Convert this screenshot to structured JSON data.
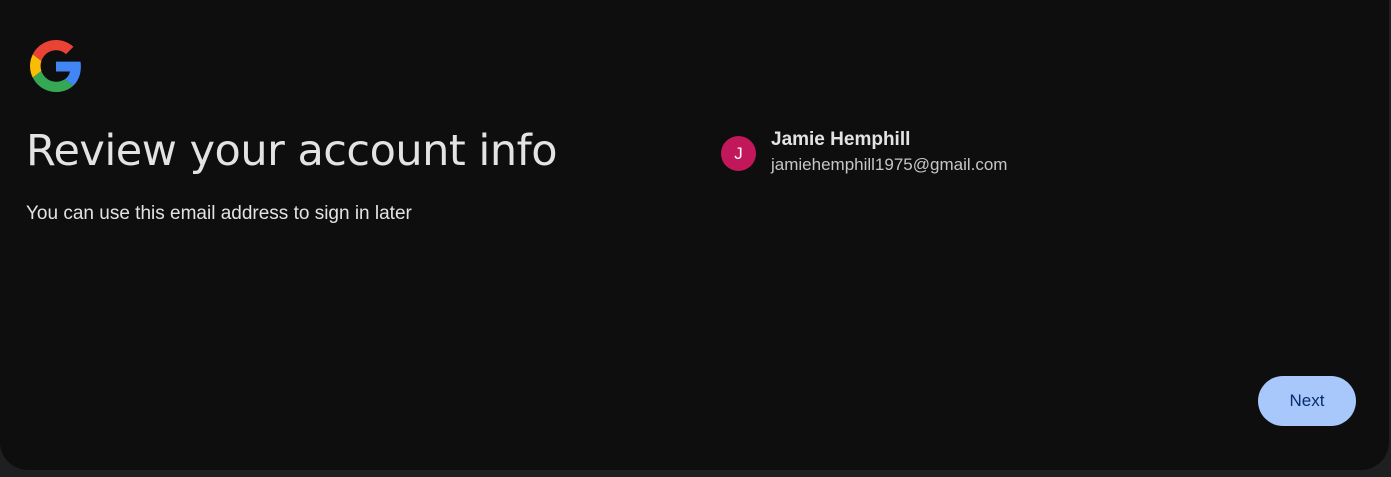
{
  "brand": {
    "logo_icon": "google-g-icon",
    "colors": {
      "blue": "#4285F4",
      "red": "#EA4335",
      "yellow": "#FBBC05",
      "green": "#34A853"
    }
  },
  "page": {
    "title": "Review your account info",
    "subtitle": "You can use this email address to sign in later"
  },
  "account": {
    "avatar_initial": "J",
    "avatar_color": "#c2185b",
    "name": "Jamie Hemphill",
    "email": "jamiehemphill1975@gmail.com"
  },
  "actions": {
    "next_label": "Next",
    "accent": "#a8c7fa"
  }
}
